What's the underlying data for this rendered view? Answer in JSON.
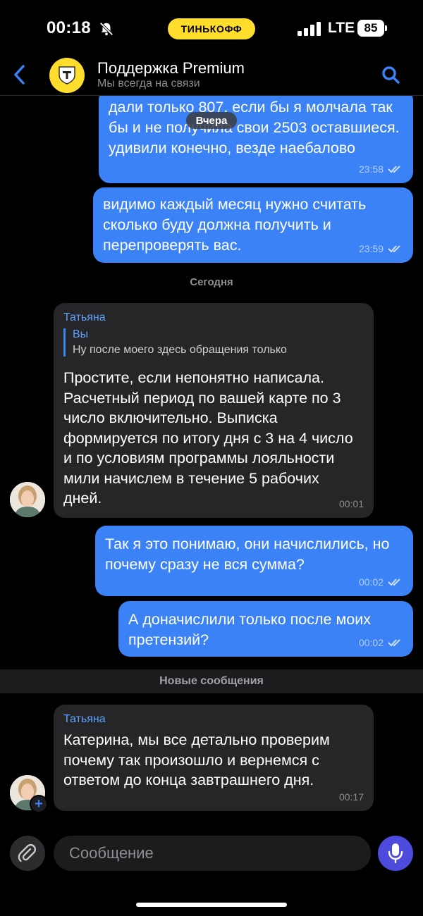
{
  "status_bar": {
    "time": "00:18",
    "brand": "ТИНЬКОФФ",
    "network": "LTE",
    "battery": "85"
  },
  "header": {
    "title": "Поддержка Premium",
    "subtitle": "Мы всегда на связи",
    "icons": [
      "chevron-left-icon",
      "bank-logo-icon",
      "search-icon"
    ]
  },
  "colors": {
    "outgoing_bubble": "#3b82f6",
    "incoming_bubble": "#262628",
    "brand_yellow": "#ffdd2d",
    "mic_button": "#4c4bdc"
  },
  "floating_date": "Вчера",
  "separators": {
    "today": "Сегодня",
    "new_messages": "Новые сообщения"
  },
  "messages": [
    {
      "direction": "out",
      "text": "дали только 807. если бы я молчала так бы и не получила свои 2503 оставшиеся. удивили конечно, везде наебалово",
      "time": "23:58"
    },
    {
      "direction": "out",
      "text": "видимо каждый месяц нужно считать сколько буду должна получить и перепроверять вас.",
      "time": "23:59"
    },
    {
      "direction": "in",
      "sender": "Татьяна",
      "reply_author": "Вы",
      "reply_text": "Ну после моего здесь обращения только",
      "text": "Простите, если непонятно написала. Расчетный период по вашей карте по 3 число включительно. Выписка формируется по итогу дня с 3 на 4 число и по условиям программы лояльности мили начислем в течение 5 рабочих дней.",
      "time": "00:01"
    },
    {
      "direction": "out",
      "text": "Так я это понимаю, они начислились, но почему сразу не вся сумма?",
      "time": "00:02"
    },
    {
      "direction": "out",
      "text": "А доначислили только после моих претензий?",
      "time": "00:02"
    },
    {
      "direction": "in",
      "sender": "Татьяна",
      "text": "Катерина, мы все детально проверим почему так произошло и вернемся с ответом до конца завтрашнего дня.",
      "time": "00:17"
    }
  ],
  "composer": {
    "placeholder": "Сообщение",
    "add_badge": "+"
  }
}
